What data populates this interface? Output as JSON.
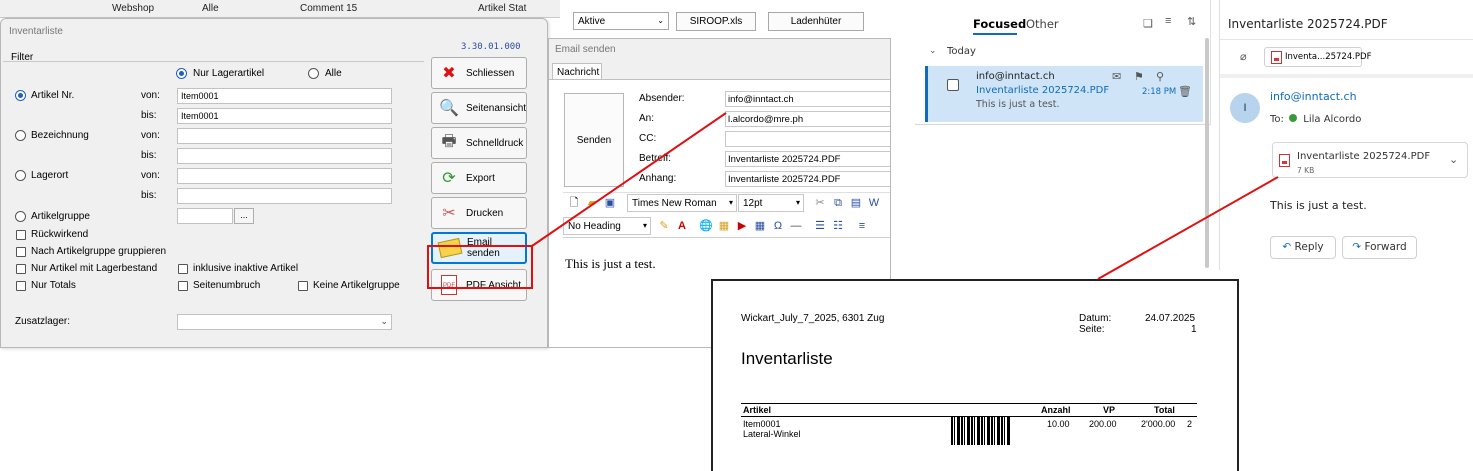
{
  "background_strip": {
    "items": [
      "Webshop",
      "Alle",
      "Comment 15",
      "Artikel Stat"
    ]
  },
  "inventar": {
    "title": "Inventarliste",
    "version": "3.30.01.000",
    "filter_label": "Filter",
    "radio_nur_lager": "Nur Lagerartikel",
    "radio_alle": "Alle",
    "rows": [
      {
        "label": "Artikel Nr.",
        "von": "Item0001",
        "bis": "Item0001"
      },
      {
        "label": "Bezeichnung",
        "von": "",
        "bis": ""
      },
      {
        "label": "Lagerort",
        "von": "",
        "bis": ""
      }
    ],
    "von_label": "von:",
    "bis_label": "bis:",
    "artikelgruppe": "Artikelgruppe",
    "dots": "...",
    "rueckwirkend": "Rückwirkend",
    "nach_gruppe": "Nach Artikelgruppe gruppieren",
    "nur_lagerbestand": "Nur Artikel mit Lagerbestand",
    "inkl_inaktive": "inklusive inaktive Artikel",
    "nur_totals": "Nur Totals",
    "seitenumbruch": "Seitenumbruch",
    "keine_gruppe": "Keine Artikelgruppe",
    "zusatzlager": "Zusatzlager:",
    "buttons": {
      "schliessen": "Schliessen",
      "seitenansicht": "Seitenansicht",
      "schnelldruck": "Schnelldruck",
      "export": "Export",
      "drucken": "Drucken",
      "email": "Email senden",
      "pdf": "PDF Ansicht"
    }
  },
  "email_top": {
    "combo": "Aktive",
    "btn1": "SIROOP.xls",
    "btn2": "Ladenhüter"
  },
  "email": {
    "title": "Email senden",
    "tab": "Nachricht",
    "send": "Senden",
    "absender_label": "Absender:",
    "absender": "info@inntact.ch",
    "an_label": "An:",
    "an": "l.alcordo@mre.ph",
    "cc_label": "CC:",
    "cc": "",
    "betreff_label": "Betreff:",
    "betreff": "Inventarliste 2025724.PDF",
    "anhang_label": "Anhang:",
    "anhang": "Inventarliste 2025724.PDF",
    "font": "Times New Roman",
    "size": "12pt",
    "style": "No Heading",
    "body": "This is just a test."
  },
  "outlook": {
    "tab_focused": "Focused",
    "tab_other": "Other",
    "group": "Today",
    "item": {
      "from": "info@inntact.ch",
      "subject": "Inventarliste 2025724.PDF",
      "preview": "This is just a test.",
      "time": "2:18 PM"
    },
    "reading": {
      "subject": "Inventarliste 2025724.PDF",
      "attachment_short": "Inventa...25724.PDF",
      "avatar": "I",
      "from": "info@inntact.ch",
      "to_label": "To:",
      "to": "Lila Alcordo",
      "attachment_name": "Inventarliste 2025724.PDF",
      "attachment_size": "7 KB",
      "body": "This is just a test.",
      "reply": "Reply",
      "forward": "Forward"
    }
  },
  "report": {
    "company": "Wickart_July_7_2025, 6301 Zug",
    "datum_label": "Datum:",
    "datum": "24.07.2025",
    "seite_label": "Seite:",
    "seite": "1",
    "title": "Inventarliste",
    "col_artikel": "Artikel",
    "col_anzahl": "Anzahl",
    "col_vp": "VP",
    "col_total": "Total",
    "row": {
      "artikel": "Item0001",
      "desc": "Lateral-Winkel",
      "anzahl": "10.00",
      "vp": "200.00",
      "total": "2'000.00",
      "extra": "2"
    }
  },
  "colors": {
    "accent": "#0f6cbd",
    "highlight": "#e01010",
    "selection": "#cfe4f7"
  }
}
